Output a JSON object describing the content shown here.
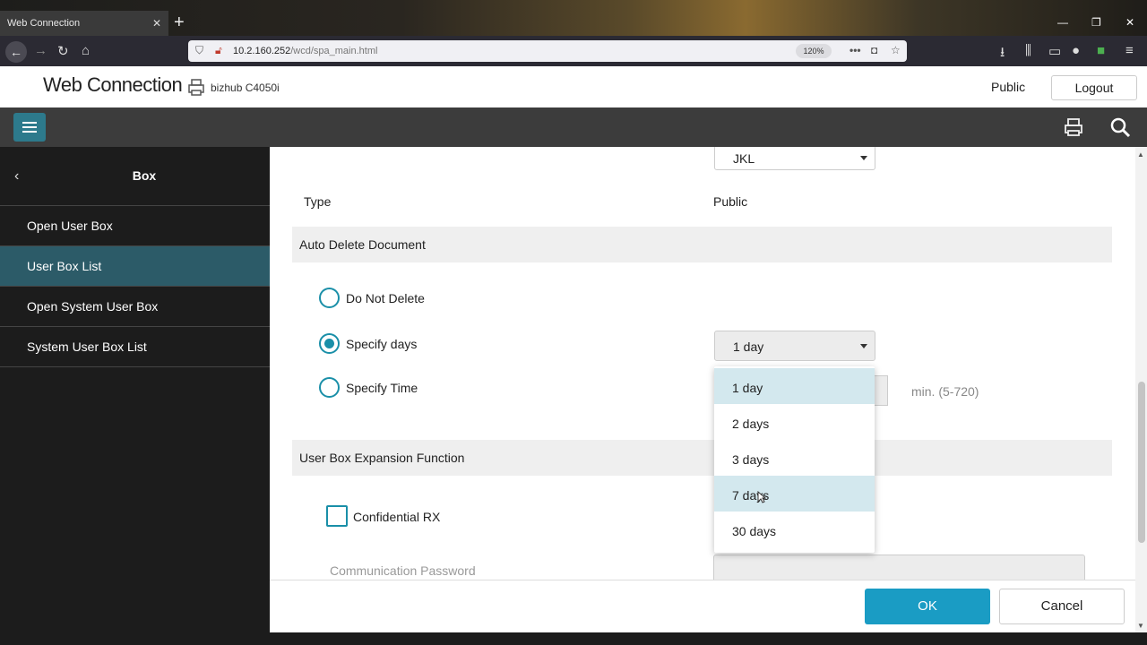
{
  "browser": {
    "tab_title": "Web Connection",
    "tab_close": "✕",
    "new_tab": "+",
    "url_host": "10.2.160.252",
    "url_path": "/wcd/spa_main.html",
    "zoom": "120%"
  },
  "header": {
    "brand": "Web Connection",
    "model": "bizhub C4050i",
    "user": "Public",
    "logout_label": "Logout"
  },
  "sidebar": {
    "title": "Box",
    "items": [
      {
        "label": "Open User Box"
      },
      {
        "label": "User Box List"
      },
      {
        "label": "Open System User Box"
      },
      {
        "label": "System User Box List"
      }
    ]
  },
  "form": {
    "top_select_value": "JKL",
    "type_label": "Type",
    "type_value": "Public",
    "auto_delete_section": "Auto Delete Document",
    "radio_do_not_delete": "Do Not Delete",
    "radio_specify_days": "Specify days",
    "radio_specify_time": "Specify Time",
    "days_select_value": "1 day",
    "time_hint": "min. (5-720)",
    "expansion_section": "User Box Expansion Function",
    "confidential_rx": "Confidential RX",
    "comm_password": "Communication Password"
  },
  "dropdown": {
    "options": [
      "1 day",
      "2 days",
      "3 days",
      "7 days",
      "30 days"
    ],
    "selected_index": 0,
    "hover_index": 3
  },
  "footer": {
    "ok_label": "OK",
    "cancel_label": "Cancel"
  },
  "colors": {
    "accent": "#1a8fa8",
    "primary_button": "#1a9cc4",
    "sidebar_active": "#2c5b68"
  }
}
